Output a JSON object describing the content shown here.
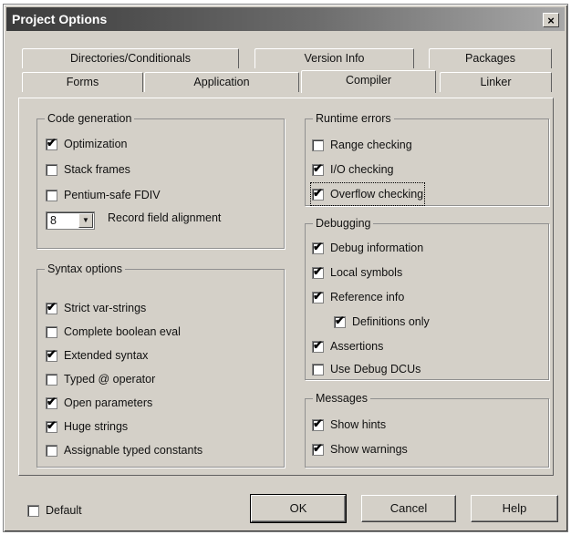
{
  "window": {
    "title": "Project Options",
    "close_glyph": "×"
  },
  "tabs": {
    "row1": [
      "Directories/Conditionals",
      "Version Info",
      "Packages"
    ],
    "row2": [
      "Forms",
      "Application",
      "Compiler",
      "Linker"
    ]
  },
  "code_generation": {
    "legend": "Code generation",
    "items": [
      {
        "label": "Optimization",
        "checked": true
      },
      {
        "label": "Stack frames",
        "checked": false
      },
      {
        "label": "Pentium-safe FDIV",
        "checked": false
      }
    ],
    "alignment_value": "8",
    "alignment_label": "Record field alignment"
  },
  "syntax_options": {
    "legend": "Syntax options",
    "items": [
      {
        "label": "Strict var-strings",
        "checked": true
      },
      {
        "label": "Complete boolean eval",
        "checked": false
      },
      {
        "label": "Extended syntax",
        "checked": true
      },
      {
        "label": "Typed @ operator",
        "checked": false
      },
      {
        "label": "Open parameters",
        "checked": true
      },
      {
        "label": "Huge strings",
        "checked": true
      },
      {
        "label": "Assignable typed constants",
        "checked": false
      }
    ]
  },
  "runtime_errors": {
    "legend": "Runtime errors",
    "items": [
      {
        "label": "Range checking",
        "checked": false
      },
      {
        "label": "I/O checking",
        "checked": true
      },
      {
        "label": "Overflow checking",
        "checked": true
      }
    ]
  },
  "debugging": {
    "legend": "Debugging",
    "items": [
      {
        "label": "Debug information",
        "checked": true
      },
      {
        "label": "Local symbols",
        "checked": true
      },
      {
        "label": "Reference info",
        "checked": true
      },
      {
        "label": "Definitions only",
        "checked": true
      },
      {
        "label": "Assertions",
        "checked": true
      },
      {
        "label": "Use Debug DCUs",
        "checked": false
      }
    ]
  },
  "messages": {
    "legend": "Messages",
    "items": [
      {
        "label": "Show hints",
        "checked": true
      },
      {
        "label": "Show warnings",
        "checked": true
      }
    ]
  },
  "footer": {
    "default_label": "Default",
    "default_checked": false,
    "ok": "OK",
    "cancel": "Cancel",
    "help": "Help"
  }
}
